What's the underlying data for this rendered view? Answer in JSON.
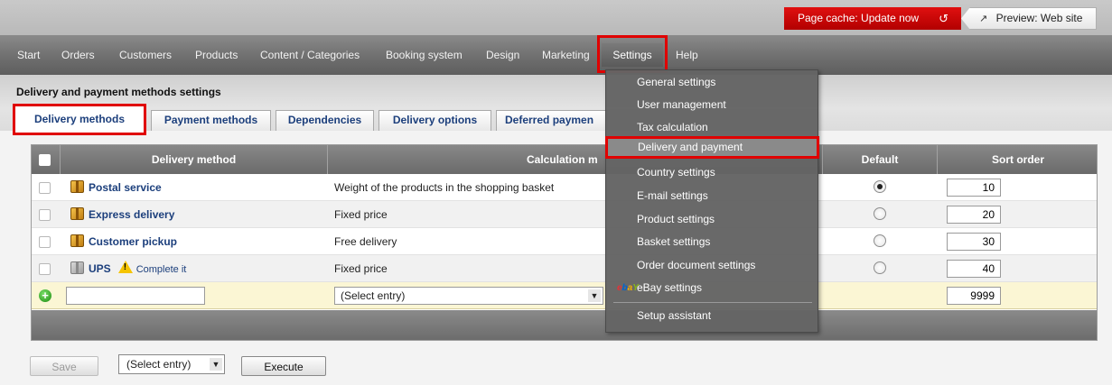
{
  "topbar": {
    "cache_label": "Page cache: Update now",
    "preview_label": "Preview: Web site"
  },
  "nav": {
    "items": [
      "Start",
      "Orders",
      "Customers",
      "Products",
      "Content / Categories",
      "Booking system",
      "Design",
      "Marketing",
      "Settings",
      "Help"
    ],
    "active": "Settings"
  },
  "page": {
    "title": "Delivery and payment methods settings"
  },
  "tabs": [
    "Delivery methods",
    "Payment methods",
    "Dependencies",
    "Delivery options",
    "Deferred paymen"
  ],
  "table": {
    "columns": {
      "method": "Delivery method",
      "calc": "Calculation m",
      "default": "Default",
      "sort": "Sort order"
    },
    "rows": [
      {
        "name": "Postal service",
        "calc": "Weight of the products in the shopping basket",
        "default": true,
        "sort": "10",
        "icon": "package-icon"
      },
      {
        "name": "Express delivery",
        "calc": "Fixed price",
        "default": false,
        "sort": "20",
        "icon": "package-icon"
      },
      {
        "name": "Customer pickup",
        "calc": "Free delivery",
        "default": false,
        "sort": "30",
        "icon": "package-icon"
      },
      {
        "name": "UPS",
        "calc": "Fixed price",
        "default": false,
        "sort": "40",
        "icon": "package-gray-icon",
        "warning": "Complete it"
      }
    ],
    "new_row": {
      "select_label": "(Select entry)",
      "sort": "9999"
    }
  },
  "actions": {
    "save_label": "Save",
    "select_label": "(Select entry)",
    "execute_label": "Execute"
  },
  "settings_menu": {
    "items": [
      "General settings",
      "User management",
      "Tax calculation",
      "Delivery and payment",
      "Country settings",
      "E-mail settings",
      "Product settings",
      "Basket settings",
      "Order document settings",
      "eBay settings"
    ],
    "footer_item": "Setup assistant",
    "highlighted": "Delivery and payment"
  },
  "colors": {
    "highlight_red": "#e00000",
    "cache_red": "#c80000",
    "link_blue": "#1c3f7c",
    "nav_gray": "#6f6f6f",
    "new_row_yellow": "#fbf6d4"
  }
}
